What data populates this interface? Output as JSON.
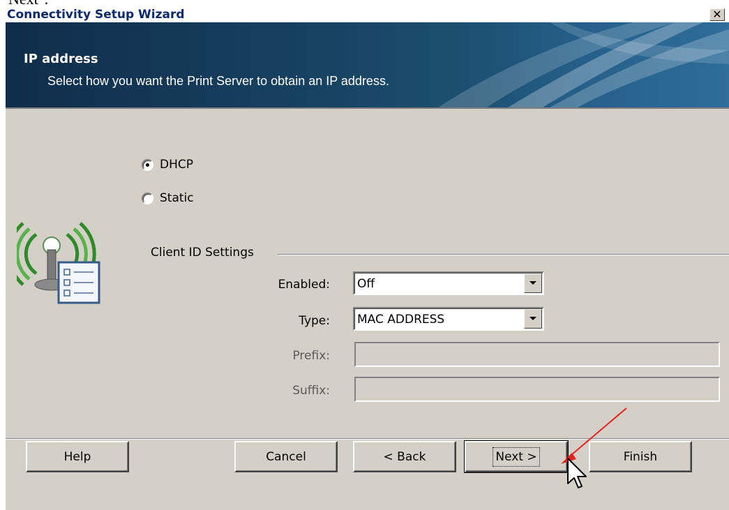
{
  "doc_fragment": "Next\".",
  "window": {
    "title": "Connectivity Setup Wizard",
    "close_glyph": "✕"
  },
  "header": {
    "title": "IP address",
    "subtitle": "Select how you want the Print Server to obtain an IP address."
  },
  "ip_mode": {
    "options": [
      {
        "label": "DHCP",
        "selected": true
      },
      {
        "label": "Static",
        "selected": false
      }
    ]
  },
  "client_id": {
    "group_label": "Client ID Settings",
    "enabled": {
      "label": "Enabled:",
      "value": "Off"
    },
    "type": {
      "label": "Type:",
      "value": "MAC ADDRESS"
    },
    "prefix": {
      "label": "Prefix:",
      "value": ""
    },
    "suffix": {
      "label": "Suffix:",
      "value": ""
    }
  },
  "buttons": {
    "help": "Help",
    "cancel": "Cancel",
    "back": "< Back",
    "next": "Next >",
    "finish": "Finish"
  },
  "icons": {
    "wizard": "wireless-network-settings-icon",
    "annotation": "red-arrow-annotation",
    "cursor": "mouse-pointer-icon"
  },
  "colors": {
    "window_bg": "#d4d0c8",
    "header_bg": "#184363",
    "title_text": "#0b2a6e",
    "annotation_red": "#e8231f"
  }
}
